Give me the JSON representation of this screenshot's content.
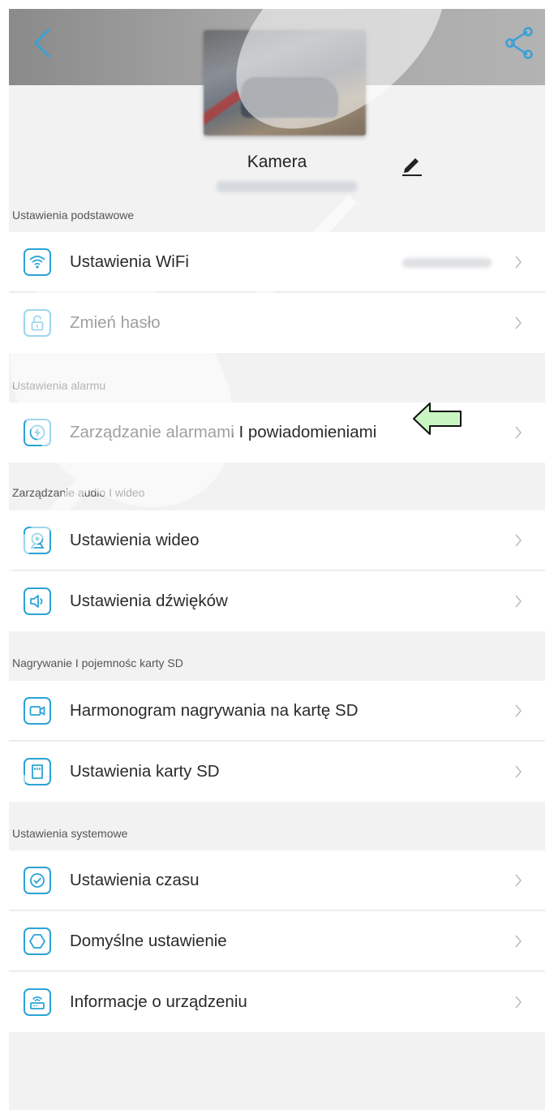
{
  "header": {
    "camera_name": "Kamera",
    "back_icon": "back-icon",
    "share_icon": "share-icon",
    "edit_icon": "pencil-icon"
  },
  "colors": {
    "accent": "#2aa4d5",
    "arrow_fill": "#c9f5c3",
    "background": "#f2f2f2"
  },
  "sections": [
    {
      "title": "Ustawienia podstawowe",
      "items": [
        {
          "label": "Ustawienia WiFi",
          "icon": "wifi-icon"
        },
        {
          "label": "Zmień hasło",
          "icon": "lock-icon"
        }
      ]
    },
    {
      "title": "Ustawienia alarmu",
      "items": [
        {
          "label": "Zarządzanie alarmami I powiadomieniami",
          "icon": "alarm-icon"
        }
      ]
    },
    {
      "title": "Zarządzanie audio I wideo",
      "items": [
        {
          "label": "Ustawienia wideo",
          "icon": "webcam-icon"
        },
        {
          "label": "Ustawienia dźwięków",
          "icon": "speaker-icon"
        }
      ]
    },
    {
      "title": "Nagrywanie I pojemnośc karty SD",
      "items": [
        {
          "label": "Harmonogram nagrywania na kartę SD",
          "icon": "video-record-icon"
        },
        {
          "label": "Ustawienia karty SD",
          "icon": "sd-card-icon"
        }
      ]
    },
    {
      "title": "Ustawienia systemowe",
      "items": [
        {
          "label": "Ustawienia czasu",
          "icon": "clock-icon"
        },
        {
          "label": "Domyślne ustawienie",
          "icon": "reset-icon"
        },
        {
          "label": "Informacje o urządzeniu",
          "icon": "device-info-icon"
        }
      ]
    }
  ]
}
